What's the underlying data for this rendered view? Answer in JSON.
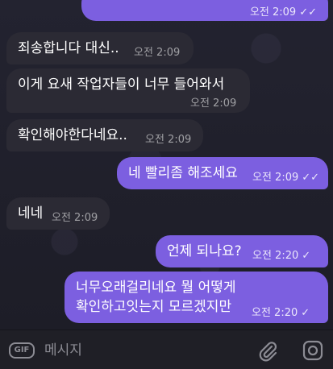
{
  "messages": [
    {
      "text": "",
      "time": "오전 2:09",
      "read": "✓✓",
      "dir": "out"
    },
    {
      "text": "죄송합니다 대신..",
      "time": "오전 2:09",
      "dir": "in"
    },
    {
      "text": "이게 요새 작업자들이 너무 들어와서",
      "time": "오전 2:09",
      "dir": "in"
    },
    {
      "text": "확인해야한다네요..",
      "time": "오전 2:09",
      "dir": "in"
    },
    {
      "text": "네 빨리좀 해조세요",
      "time": "오전 2:09",
      "read": "✓✓",
      "dir": "out"
    },
    {
      "text": "네네",
      "time": "오전 2:09",
      "dir": "in"
    },
    {
      "text": "언제 되나요?",
      "time": "오전 2:20",
      "read": "✓",
      "dir": "out"
    },
    {
      "text": "너무오래걸리네요 뭘 어떻게",
      "text2": "확인하고잇는지 모르겠지만",
      "time": "오전 2:20",
      "read": "✓",
      "dir": "out"
    }
  ],
  "input": {
    "gif_label": "GIF",
    "placeholder": "메시지"
  },
  "icons": {
    "attach": "paperclip-icon",
    "camera": "camera-icon",
    "gif": "gif-icon",
    "read_receipt": "double-check-icon"
  },
  "colors": {
    "outgoing": "#7c5fe0",
    "incoming": "#2b2a34",
    "background": "#1d1d27"
  }
}
